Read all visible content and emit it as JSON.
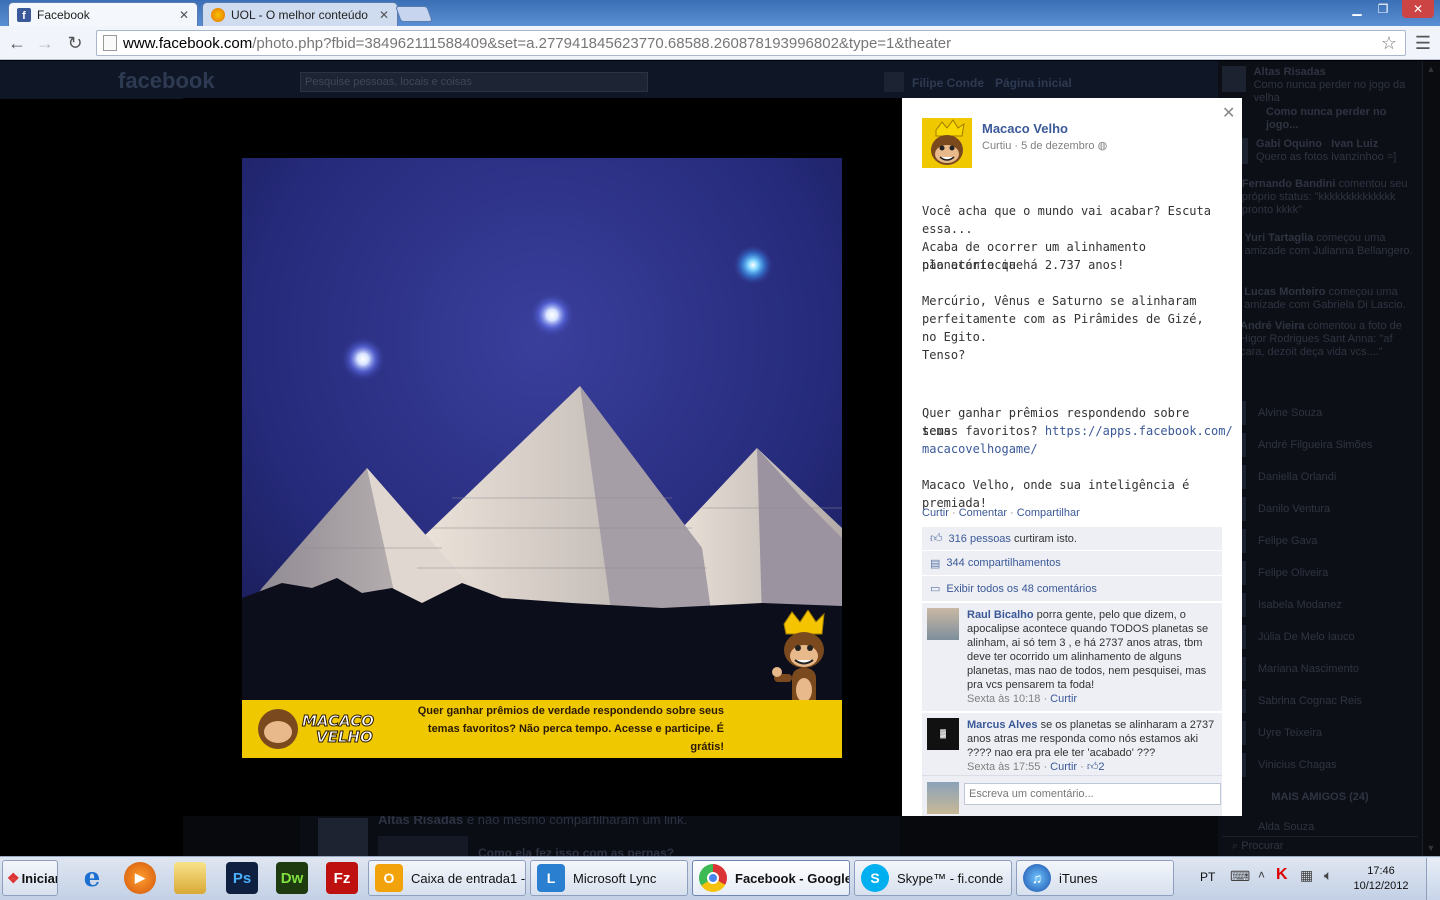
{
  "browser": {
    "tabs": [
      {
        "label": "Facebook",
        "favicon": "facebook-favicon"
      },
      {
        "label": "UOL - O melhor conteúdo",
        "favicon": "uol-favicon"
      }
    ],
    "url_host": "www.facebook.com",
    "url_path": "/photo.php?fbid=384962111588409&set=a.277941845623770.68588.260878193996802&type=1&theater"
  },
  "facebook": {
    "logo": "facebook",
    "search_placeholder": "Pesquise pessoas, locais e coisas",
    "header_user": "Filipe Conde",
    "header_home": "Página inicial",
    "behind_post_author": "Altas Risadas",
    "behind_post_action": "e não mesmo compartilharam um link.",
    "behind_post_title": "Como ela fez isso com as pernas?",
    "sidebar_ticker": [
      {
        "name": "Altas Risadas",
        "text": "Como nunca perder no jogo da velha"
      },
      {
        "name": "",
        "text": "Como nunca perder no jogo..."
      },
      {
        "name": "Gabi Oquino",
        "name2": "Ivan Luiz",
        "text": "Quero as fotos ivanzinhoo =]"
      },
      {
        "name": "Fernando Bandini",
        "text": "comentou seu próprio status: \"kkkkkkkkkkkkkk pronto kkkk\""
      },
      {
        "name": "Yuri Tartaglia",
        "text": "começou uma amizade com Julianna Bellangero."
      },
      {
        "name": "Lucas Monteiro",
        "text": "começou uma amizade com Gabriela Di Lascio."
      },
      {
        "name": "André Vieira",
        "text": "comentou a foto de Higor Rodrigues Sant Anna: \"af cara, dezoit deça vida vcs....\""
      }
    ],
    "sidebar_chat": [
      "Alvine Souza",
      "André Filgueira Simões",
      "Daniella Orlandi",
      "Danilo Ventura",
      "Felipe Gava",
      "Felipe Oliveira",
      "Isabela Modanez",
      "Júlia De Melo Iauco",
      "Mariana Nascimento",
      "Sabrina Cognac Reis",
      "Uyre Teixeira",
      "Vinicius Chagas"
    ],
    "sidebar_more": "MAIS AMIGOS (24)",
    "sidebar_last": "Alda Souza",
    "sidebar_search": "Procurar"
  },
  "photo": {
    "banner_logo_line1": "MACACO",
    "banner_logo_line2": "VELHO",
    "banner_text": "Quer ganhar prêmios de verdade respondendo sobre seus temas favoritos? Não perca tempo. Acesse e participe. É grátis!"
  },
  "panel": {
    "page_name": "Macaco Velho",
    "meta_curtiu": "Curtiu",
    "meta_date": "5 de dezembro",
    "post_lines": [
      "Você acha que o mundo vai acabar? Escuta essa...",
      "",
      "Acaba de ocorrer um alinhamento planetário que",
      "não acontecia há 2.737 anos!",
      "",
      "Mercúrio, Vênus e Saturno se alinharam",
      "perfeitamente com as Pirâmides de Gizé, no Egito.",
      "",
      "Tenso?",
      "",
      "",
      "Quer ganhar prêmios respondendo sobre seus",
      "temas favoritos? "
    ],
    "post_link_1": "https://apps.facebook.com/",
    "post_link_2": "macacovelhogame/",
    "post_footer": "Macaco Velho, onde sua inteligência é premiada!",
    "actions": [
      "Curtir",
      "Comentar",
      "Compartilhar"
    ],
    "likes_link": "316 pessoas",
    "likes_rest": " curtiram isto.",
    "shares": "344 compartilhamentos",
    "view_comments": "Exibir todos os 48 comentários",
    "comments": [
      {
        "author": "Raul Bicalho",
        "text": " porra gente, pelo que dizem, o apocalipse acontece quando TODOS planetas se alinham, ai só tem 3 , e há 2737 anos atras, tbm deve ter ocorrido um alinhamento de alguns planetas, mas nao de todos, nem pesquisei, mas pra vcs pensarem ta foda!",
        "time": "Sexta às 10:18",
        "action": "Curtir"
      },
      {
        "author": "Marcus Alves",
        "text": " se os planetas se alinharam a 2737 anos atras me responda como nós estamos aki ???? nao era pra ele ter 'acabado' ???",
        "time": "Sexta às 17:55",
        "action": "Curtir",
        "likes": "2"
      }
    ],
    "comment_placeholder": "Escreva um comentário..."
  },
  "taskbar": {
    "start": "Iniciar",
    "quick": [
      "ie-icon",
      "media-player-icon",
      "explorer-icon",
      "photoshop-icon",
      "dreamweaver-icon",
      "filezilla-icon"
    ],
    "quick_labels": {
      "photoshop": "Ps",
      "dreamweaver": "Dw",
      "filezilla": "Fz"
    },
    "buttons": [
      {
        "label": "Caixa de entrada1 - ...",
        "icon": "outlook-icon"
      },
      {
        "label": "Microsoft Lync",
        "icon": "lync-icon"
      },
      {
        "label": "Facebook - Google ...",
        "icon": "chrome-icon"
      },
      {
        "label": "Skype™ - fi.conde",
        "icon": "skype-icon"
      },
      {
        "label": "iTunes",
        "icon": "itunes-icon"
      }
    ],
    "lang": "PT",
    "clock_time": "17:46",
    "clock_date": "10/12/2012"
  },
  "colors": {
    "facebook_blue": "#3b5998",
    "banner_yellow": "#f0c800",
    "panel_bg": "#ffffff",
    "ufi_bg": "#edeff4"
  }
}
